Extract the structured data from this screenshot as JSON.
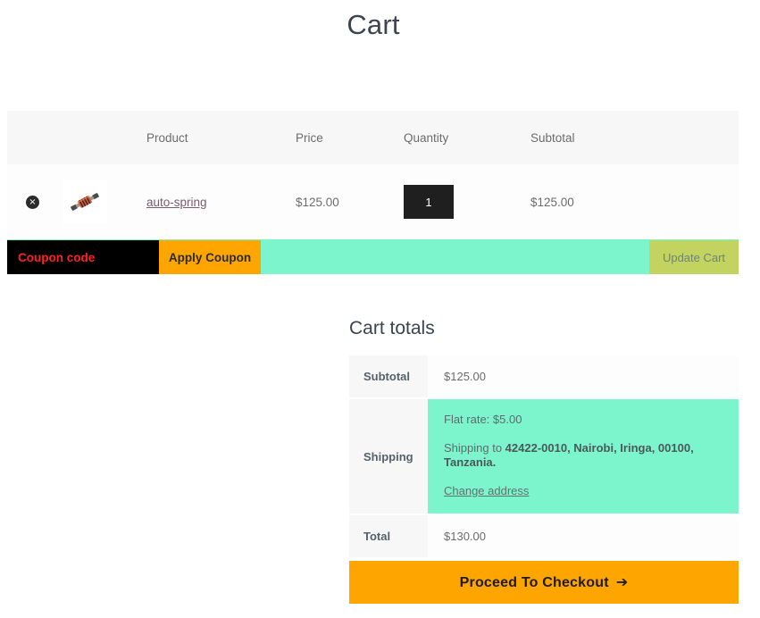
{
  "page": {
    "title": "Cart"
  },
  "cart_table": {
    "headers": {
      "remove": "",
      "thumbnail": "",
      "product": "Product",
      "price": "Price",
      "quantity": "Quantity",
      "subtotal": "Subtotal"
    },
    "items": [
      {
        "remove_icon": "remove-circle-icon",
        "remove_label": "×",
        "thumbnail_icon": "product-thumbnail-auto-spring",
        "name": "auto-spring",
        "price": "$125.00",
        "quantity": "1",
        "subtotal": "$125.00"
      }
    ],
    "coupon": {
      "placeholder": "Coupon code",
      "value": "",
      "apply_label": "Apply Coupon",
      "update_label": "Update Cart"
    }
  },
  "cart_totals": {
    "title": "Cart totals",
    "subtotal_label": "Subtotal",
    "subtotal_value": "$125.00",
    "shipping_label": "Shipping",
    "shipping_rate": "Flat rate: $5.00",
    "shipping_to_prefix": "Shipping to ",
    "shipping_address": "42422-0010, Nairobi, Iringa, 00100, Tanzania.",
    "change_address_label": "Change address",
    "total_label": "Total",
    "total_value": "$130.00"
  },
  "checkout": {
    "label": "Proceed To Checkout",
    "arrow": "➔"
  },
  "colors": {
    "accent_orange": "#ffa500",
    "mint": "#7cf5cd",
    "olive_disabled": "#c3d35f",
    "coupon_bg": "#000000",
    "coupon_text": "#ff2020",
    "qty_bg": "#1f1f1f",
    "title_text": "#3d4351",
    "header_bg": "#f7f7f7"
  }
}
